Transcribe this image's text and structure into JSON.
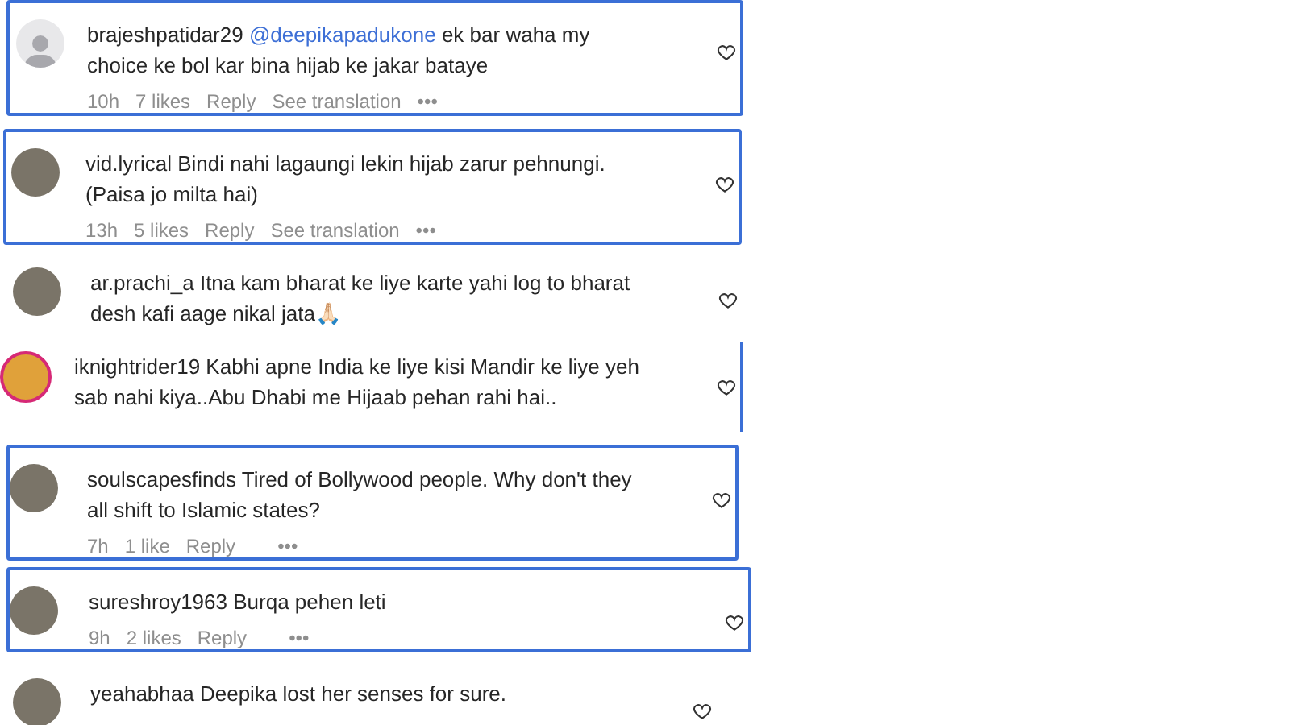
{
  "comments": [
    {
      "username": "brajeshpatidar29",
      "kind": "default",
      "highlighted": true,
      "text": [
        {
          "kind": "mention",
          "text": "@deepikapadukone"
        },
        {
          "kind": "plain",
          "text": " ek bar waha my choice ke bol kar bina hijab ke jakar bataye"
        }
      ],
      "time": "10h",
      "likes": "7 likes",
      "reply": "Reply",
      "see_translation": "See translation",
      "more": "•••"
    },
    {
      "username": "vid.lyrical",
      "kind": "photo",
      "highlighted": true,
      "text": [
        {
          "kind": "plain",
          "text": "Bindi nahi lagaungi lekin hijab zarur pehnungi. (Paisa jo milta hai)"
        }
      ],
      "time": "13h",
      "likes": "5 likes",
      "reply": "Reply",
      "see_translation": "See translation",
      "more": "•••"
    },
    {
      "username": "ar.prachi_a",
      "kind": "photo",
      "highlighted": false,
      "text": [
        {
          "kind": "plain",
          "text": "Itna kam bharat ke liye karte yahi log to bharat desh kafi aage nikal jata🙏🏻"
        }
      ]
    },
    {
      "username": "iknightrider19",
      "kind": "story",
      "highlighted": false,
      "text": [
        {
          "kind": "plain",
          "text": "Kabhi apne India ke liye kisi Mandir ke liye yeh sab nahi kiya..Abu Dhabi me Hijaab pehan rahi hai.."
        }
      ]
    },
    {
      "username": "soulscapesfinds",
      "kind": "photo",
      "highlighted": true,
      "text": [
        {
          "kind": "plain",
          "text": "Tired of Bollywood people. Why don't they all shift to Islamic states?"
        }
      ],
      "time": "7h",
      "likes": "1 like",
      "reply": "Reply",
      "more": "•••"
    },
    {
      "username": "sureshroy1963",
      "kind": "photo",
      "highlighted": true,
      "text": [
        {
          "kind": "plain",
          "text": "Burqa pehen leti"
        }
      ],
      "time": "9h",
      "likes": "2 likes",
      "reply": "Reply",
      "more": "•••"
    },
    {
      "username": "yeahabhaa",
      "kind": "photo",
      "highlighted": false,
      "text": [
        {
          "kind": "plain",
          "text": "Deepika lost her senses for sure."
        }
      ]
    }
  ]
}
